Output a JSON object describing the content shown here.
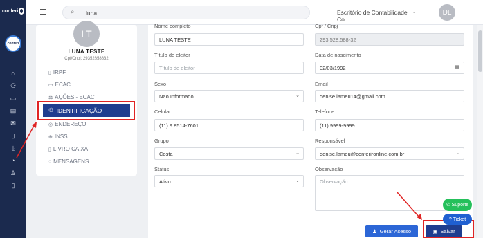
{
  "brand": {
    "logo_text": "conferi",
    "logo_circle_text": "conferi"
  },
  "topbar": {
    "search_value": "luna",
    "office_selected": "Escritório de Contabilidade Co",
    "user_initials": "DL"
  },
  "sidebar_icons": [
    "home-icon",
    "users-icon",
    "inbox-icon",
    "cards-icon",
    "mail-icon",
    "document-icon",
    "download-icon",
    "clock-icon",
    "user-plus-icon",
    "file-icon"
  ],
  "profile": {
    "initials": "LT",
    "name": "LUNA TESTE",
    "doc": "Cpf/Cnpj: 29352858832",
    "menu": [
      {
        "label": "IRPF",
        "icon": "file-icon"
      },
      {
        "label": "ECAC",
        "icon": "monitor-icon"
      },
      {
        "label": "AÇÕES - ECAC",
        "icon": "gavel-icon"
      },
      {
        "label": "IDENTIFICAÇÃO",
        "icon": "user-id-icon",
        "active": true
      },
      {
        "label": "ENDEREÇO",
        "icon": "pin-icon"
      },
      {
        "label": "INSS",
        "icon": "shield-icon"
      },
      {
        "label": "LIVRO CAIXA",
        "icon": "book-icon"
      },
      {
        "label": "MENSAGENS",
        "icon": "chat-icon"
      }
    ]
  },
  "form": {
    "nome_label": "Nome completo",
    "nome_value": "LUNA TESTE",
    "cpf_label": "Cpf / Cnpj",
    "cpf_value": "293.528.588-32",
    "titulo_label": "Título de eleitor",
    "titulo_placeholder": "Título de eleitor",
    "nascimento_label": "Data de nascimento",
    "nascimento_value": "02/03/1992",
    "sexo_label": "Sexo",
    "sexo_value": "Nao Informado",
    "email_label": "Email",
    "email_value": "denise.lameu14@gmail.com",
    "celular_label": "Celular",
    "celular_value": "(11) 9 8514-7601",
    "telefone_label": "Telefone",
    "telefone_value": "(11) 9999-9999",
    "grupo_label": "Grupo",
    "grupo_value": "Costa",
    "responsavel_label": "Responsável",
    "responsavel_value": "denise.lameu@conferironline.com.br",
    "status_label": "Status",
    "status_value": "Ativo",
    "observacao_label": "Observação",
    "observacao_placeholder": "Observação"
  },
  "buttons": {
    "gerar_acesso": "Gerar Acesso",
    "salvar": "Salvar",
    "suporte": "Suporte",
    "ticket": "Ticket"
  },
  "colors": {
    "primary": "#1f3d8f",
    "accent": "#2c66d6",
    "annotation": "#e02424",
    "whatsapp": "#25c05b"
  }
}
